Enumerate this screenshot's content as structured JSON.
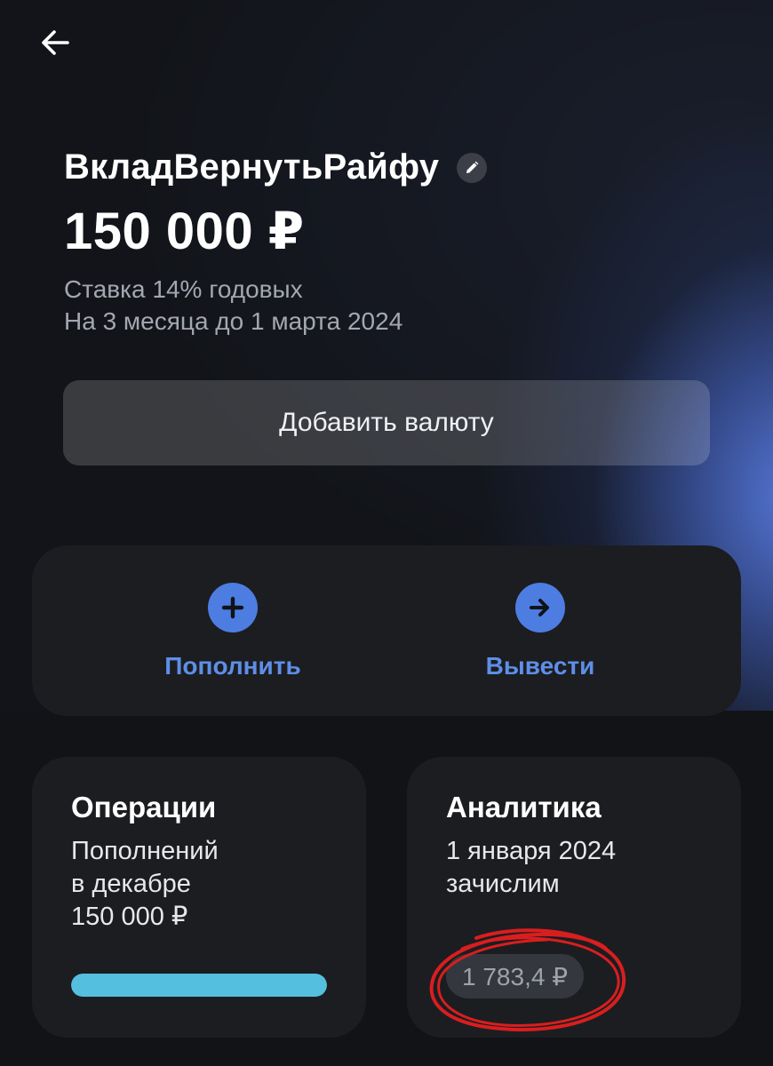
{
  "header": {
    "back_icon": "arrow-left-icon"
  },
  "deposit": {
    "name": "ВкладВернутьРайфу",
    "edit_icon": "pencil-icon",
    "amount": "150 000 ₽",
    "rate": "Ставка 14% годовых",
    "term": "На 3 месяца до 1 марта 2024"
  },
  "add_currency_label": "Добавить валюту",
  "actions": {
    "topup": {
      "label": "Пополнить",
      "icon": "plus-icon"
    },
    "withdraw": {
      "label": "Вывести",
      "icon": "arrow-right-icon"
    }
  },
  "operations_card": {
    "title": "Операции",
    "line1": "Пополнений",
    "line2": "в декабре",
    "amount": "150 000 ₽",
    "progress": 1.0
  },
  "analytics_card": {
    "title": "Аналитика",
    "line1": "1 января 2024",
    "line2": "зачислим",
    "income": "1 783,4 ₽"
  },
  "colors": {
    "accent": "#4d7de0",
    "accent_text": "#5e8fe8",
    "progress": "#55bfe0",
    "annotation": "#d81e1e"
  }
}
